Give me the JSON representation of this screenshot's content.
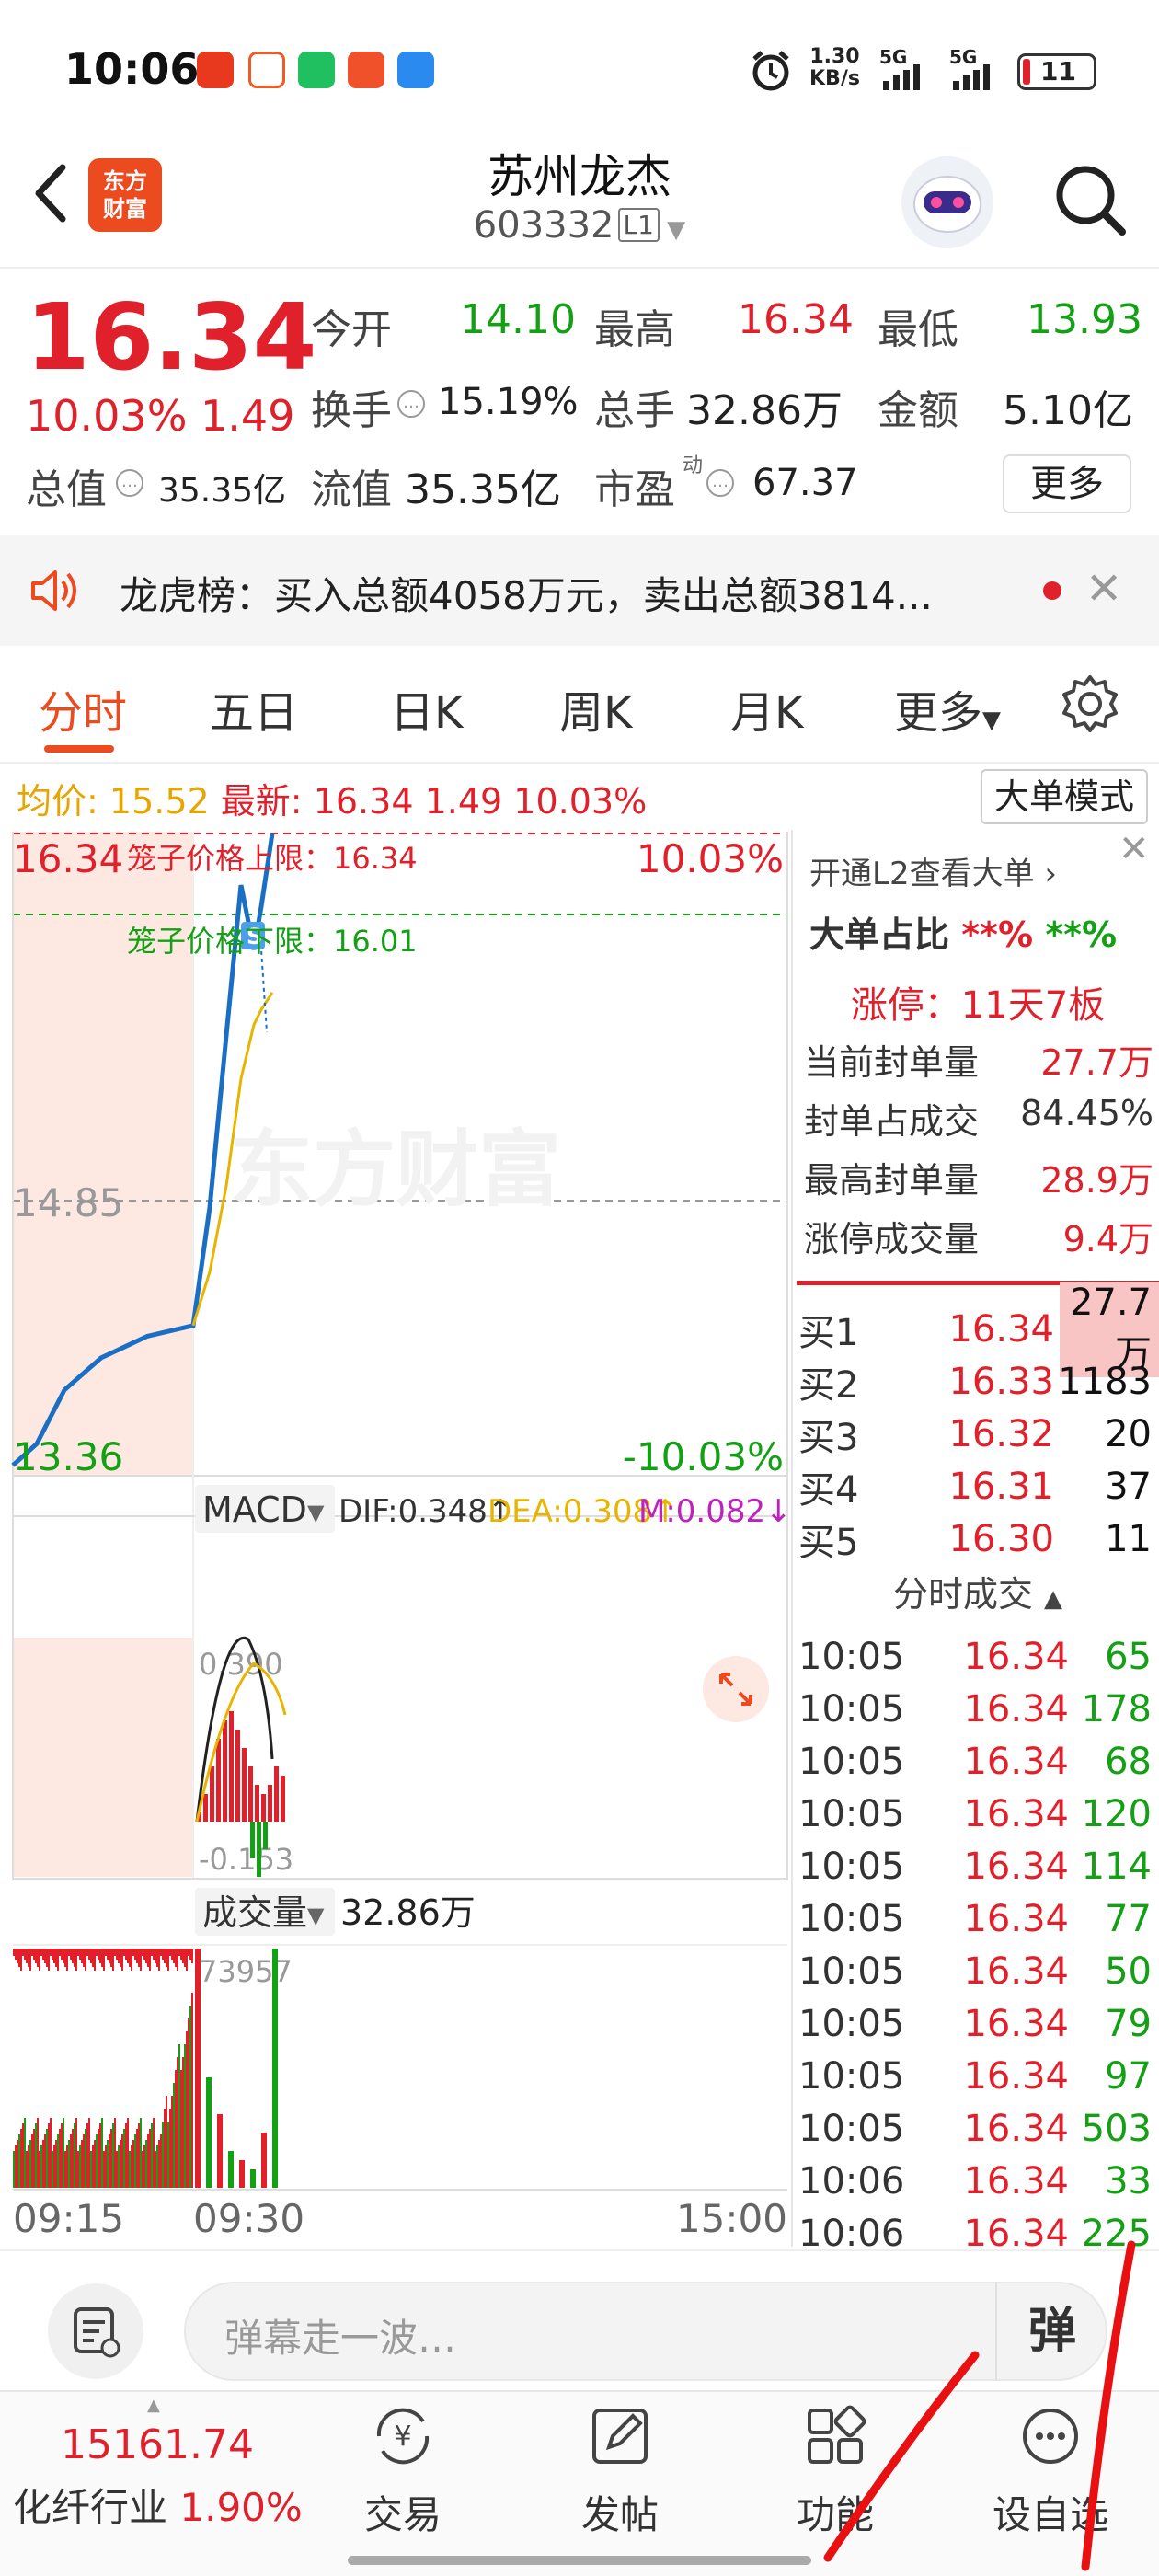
{
  "status_bar": {
    "time": "10:06",
    "net_speed_value": "1.30",
    "net_speed_unit": "KB/s",
    "sim1": "5G",
    "sim2": "5G",
    "battery": "11"
  },
  "header": {
    "logo_text_line1": "东方",
    "logo_text_line2": "财富",
    "stock_name": "苏州龙杰",
    "stock_code": "603332",
    "level_badge": "L1"
  },
  "quote": {
    "price": "16.34",
    "change_pct": "10.03%",
    "change": "1.49",
    "fields": [
      {
        "label": "今开",
        "value": "14.10",
        "color": "#14a014"
      },
      {
        "label": "最高",
        "value": "16.34",
        "color": "#e0202a"
      },
      {
        "label": "最低",
        "value": "13.93",
        "color": "#14a014"
      },
      {
        "label": "换手",
        "value": "15.19%",
        "color": "#222222"
      },
      {
        "label": "总手",
        "value": "32.86万",
        "color": "#222222"
      },
      {
        "label": "金额",
        "value": "5.10亿",
        "color": "#222222"
      },
      {
        "label": "总值",
        "value": "35.35亿",
        "color": "#222222"
      },
      {
        "label": "流值",
        "value": "35.35亿",
        "color": "#222222"
      },
      {
        "label": "市盈",
        "value": "67.37",
        "color": "#222222"
      }
    ],
    "pe_superscript": "动",
    "more_button": "更多"
  },
  "notice": {
    "text": "龙虎榜：买入总额4058万元，卖出总额3814..."
  },
  "tabs": [
    "分时",
    "五日",
    "日K",
    "周K",
    "月K",
    "更多"
  ],
  "avg_line": {
    "avg_label": "均价:",
    "avg_value": "15.52",
    "latest_label": "最新:",
    "latest_value": "16.34",
    "change": "1.49",
    "change_pct": "10.03%"
  },
  "big_order_mode_button": "大单模式",
  "chart_labels": {
    "upper_price": "16.34",
    "upper_pct": "10.03%",
    "upper_limit_label": "笼子价格上限：16.34",
    "lower_limit_label": "笼子价格下限：16.01",
    "mid_price": "14.85",
    "lower_price": "13.36",
    "lower_pct": "-10.03%",
    "watermark": "东方财富",
    "macd_selector": "MACD",
    "dif": "DIF:0.348↑",
    "dea": "DEA:0.308↑",
    "m": "M:0.082↓",
    "macd_top": "0.390",
    "macd_bottom": "-0.153",
    "volume_selector": "成交量",
    "volume_total": "32.86万",
    "volume_max": "73957",
    "time_start": "09:15",
    "time_open": "09:30",
    "time_end": "15:00"
  },
  "chart_data": {
    "type": "line",
    "x": [
      "09:15",
      "09:18",
      "09:21",
      "09:24",
      "09:27",
      "09:30",
      "09:31",
      "09:32",
      "09:33",
      "09:34",
      "09:35",
      "09:36"
    ],
    "series": [
      {
        "values": [
          13.4,
          13.5,
          13.75,
          13.9,
          14.0,
          14.05,
          14.6,
          15.4,
          16.1,
          15.8,
          16.0,
          16.34
        ]
      },
      {
        "values": [
          null,
          null,
          null,
          null,
          null,
          14.05,
          14.3,
          14.7,
          15.2,
          15.45,
          15.52,
          15.6
        ]
      }
    ],
    "ylim": [
      13.36,
      16.34
    ],
    "mid": 14.85
  },
  "right_panel": {
    "l2_link": "开通L2查看大单 ›",
    "ratio_label": "大单占比",
    "ratio_buy": "**%",
    "ratio_sell": "**%",
    "limit_up_title": "涨停：11天7板",
    "stats": [
      {
        "label": "当前封单量",
        "value": "27.7万"
      },
      {
        "label": "封单占成交",
        "value": "84.45%"
      },
      {
        "label": "最高封单量",
        "value": "28.9万"
      },
      {
        "label": "涨停成交量",
        "value": "9.4万"
      }
    ],
    "order_book": [
      {
        "label": "买1",
        "price": "16.34",
        "qty": "27.7万"
      },
      {
        "label": "买2",
        "price": "16.33",
        "qty": "1183"
      },
      {
        "label": "买3",
        "price": "16.32",
        "qty": "20"
      },
      {
        "label": "买4",
        "price": "16.31",
        "qty": "37"
      },
      {
        "label": "买5",
        "price": "16.30",
        "qty": "11"
      }
    ],
    "ticks_header": "分时成交",
    "ticks": [
      {
        "time": "10:05",
        "price": "16.34",
        "qty": "65"
      },
      {
        "time": "10:05",
        "price": "16.34",
        "qty": "178"
      },
      {
        "time": "10:05",
        "price": "16.34",
        "qty": "68"
      },
      {
        "time": "10:05",
        "price": "16.34",
        "qty": "120"
      },
      {
        "time": "10:05",
        "price": "16.34",
        "qty": "114"
      },
      {
        "time": "10:05",
        "price": "16.34",
        "qty": "77"
      },
      {
        "time": "10:05",
        "price": "16.34",
        "qty": "50"
      },
      {
        "time": "10:05",
        "price": "16.34",
        "qty": "79"
      },
      {
        "time": "10:05",
        "price": "16.34",
        "qty": "97"
      },
      {
        "time": "10:05",
        "price": "16.34",
        "qty": "503"
      },
      {
        "time": "10:06",
        "price": "16.34",
        "qty": "33"
      },
      {
        "time": "10:06",
        "price": "16.34",
        "qty": "225"
      }
    ]
  },
  "danmaku": {
    "placeholder": "弹幕走一波…",
    "send_label": "弹"
  },
  "bottom_nav": {
    "index_value": "15161.74",
    "index_name": "化纤行业",
    "index_pct": "1.90%",
    "items": [
      "交易",
      "发帖",
      "功能",
      "设自选"
    ]
  }
}
